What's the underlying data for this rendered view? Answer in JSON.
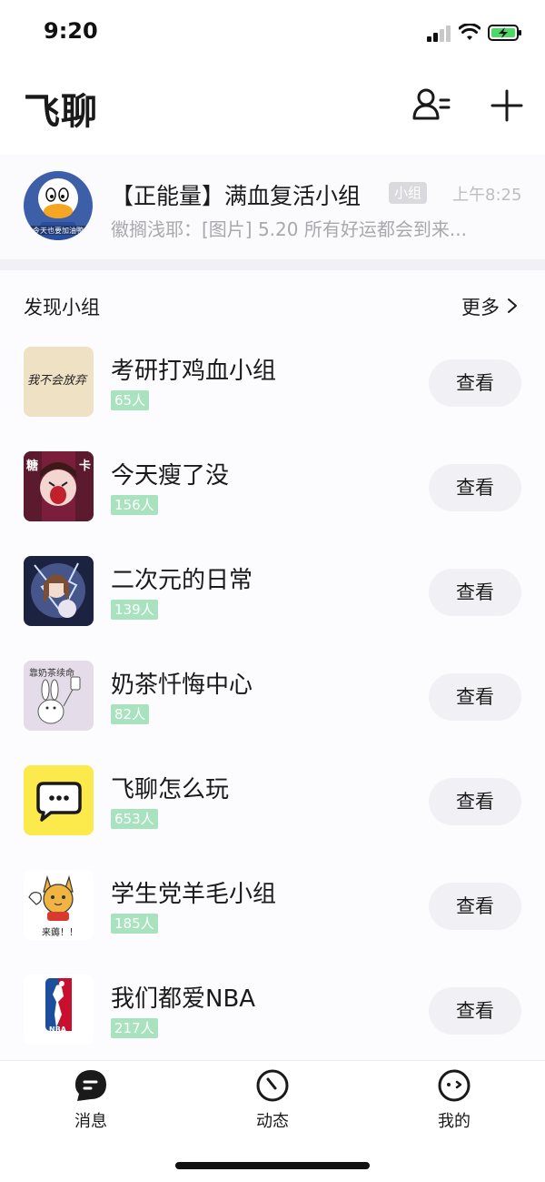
{
  "status_bar": {
    "time": "9:20"
  },
  "header": {
    "title": "飞聊"
  },
  "pinned_chat": {
    "title": "【正能量】满血复活小组",
    "tag": "小组",
    "time": "上午8:25",
    "preview": "徽搁浅耶：[图片] 5.20 所有好运都会到来...",
    "avatar_caption": "今天也要加油鸭"
  },
  "discover": {
    "title": "发现小组",
    "more_label": "更多",
    "groups": [
      {
        "name": "考研打鸡血小组",
        "members": "65人",
        "button": "查看",
        "avatar_text": "我不会放弃"
      },
      {
        "name": "今天瘦了没",
        "members": "156人",
        "button": "查看",
        "avatar_text": ""
      },
      {
        "name": "二次元的日常",
        "members": "139人",
        "button": "查看",
        "avatar_text": ""
      },
      {
        "name": "奶茶忏悔中心",
        "members": "82人",
        "button": "查看",
        "avatar_text": "靠奶茶续命"
      },
      {
        "name": "飞聊怎么玩",
        "members": "653人",
        "button": "查看",
        "avatar_text": ""
      },
      {
        "name": "学生党羊毛小组",
        "members": "185人",
        "button": "查看",
        "avatar_text": "来薅！！"
      },
      {
        "name": "我们都爱NBA",
        "members": "217人",
        "button": "查看",
        "avatar_text": "NBA"
      }
    ]
  },
  "tabs": [
    {
      "label": "消息"
    },
    {
      "label": "动态"
    },
    {
      "label": "我的"
    }
  ],
  "colors": {
    "member_badge": "#a8e2bf",
    "button_bg": "#f1f1f5",
    "yellow_brand": "#fce94b"
  }
}
